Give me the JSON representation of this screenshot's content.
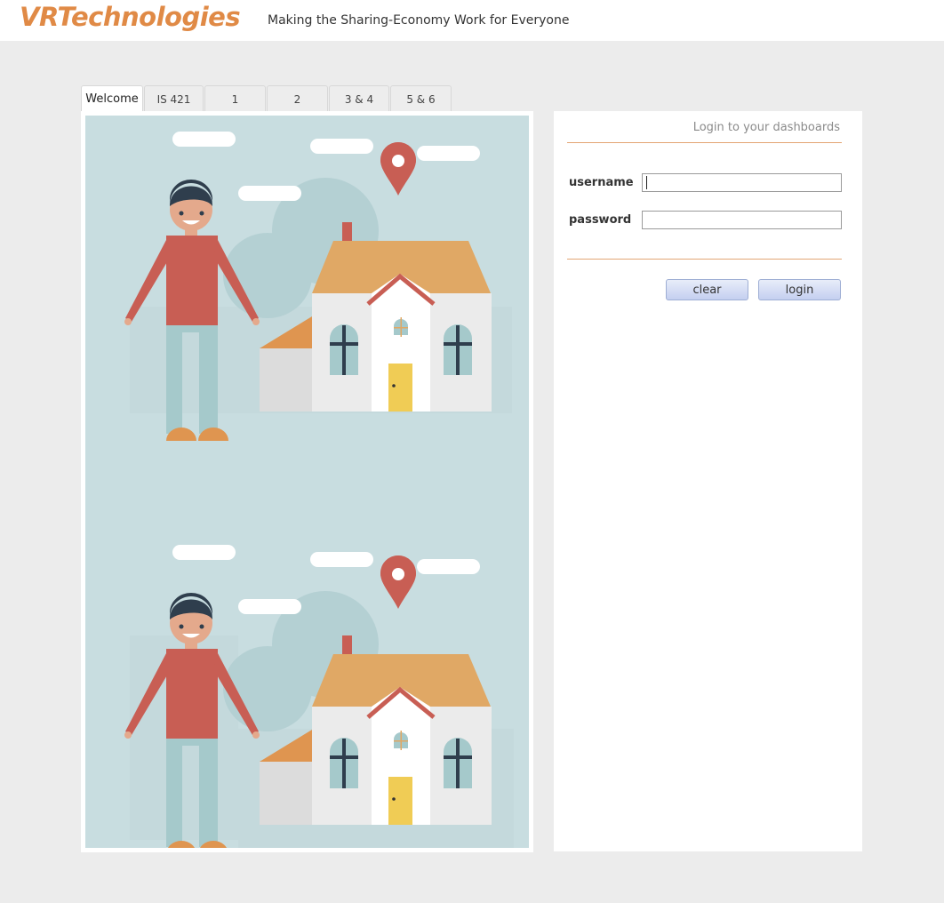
{
  "header": {
    "logo_text": "VRTechnologies",
    "tagline": "Making the Sharing-Economy Work for Everyone"
  },
  "tabs": [
    {
      "label": "Welcome",
      "active": true
    },
    {
      "label": "IS 421",
      "active": false
    },
    {
      "label": "1",
      "active": false
    },
    {
      "label": "2",
      "active": false
    },
    {
      "label": "3 & 4",
      "active": false
    },
    {
      "label": "5 & 6",
      "active": false
    }
  ],
  "login": {
    "title": "Login to your dashboards",
    "username_label": "username",
    "username_value": "",
    "password_label": "password",
    "password_value": "",
    "clear_label": "clear",
    "login_label": "login"
  },
  "colors": {
    "brand": "#e08a46",
    "background": "#ececec",
    "illustration_bg": "#c8dde0"
  }
}
